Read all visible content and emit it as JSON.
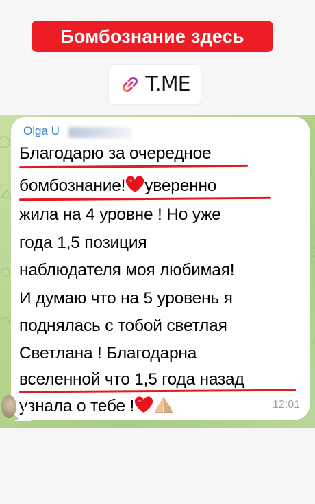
{
  "banner": {
    "headline": "Бомбознание здесь",
    "link_text": "T.ME",
    "link_icon": "link-icon",
    "headline_color": "#ee1c25"
  },
  "message": {
    "sender": "Olga U",
    "lines": [
      "Благодарю за очередное",
      "бомбознание!",
      "уверенно",
      "жила на 4 уровне ! Но уже",
      "года 1,5 позиция",
      "наблюдателя моя любимая!",
      "И думаю что на 5 уровень я",
      "поднялась с тобой светлая",
      "Светлана ! Благодарна",
      "вселенной что 1,5 года назад",
      "узнала о тебе !"
    ],
    "emojis": [
      "heart-emoji",
      "heart-emoji",
      "praying-hands-emoji"
    ],
    "time": "12:01",
    "sender_color": "#3a82c8",
    "underline_color": "#e11b22"
  }
}
